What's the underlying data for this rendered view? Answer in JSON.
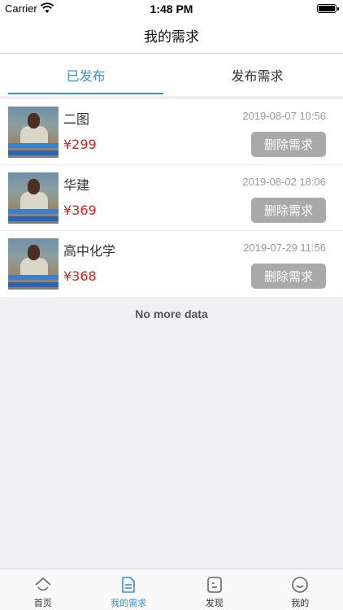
{
  "status_bar": {
    "carrier": "Carrier",
    "time": "1:48 PM"
  },
  "navbar": {
    "title": "我的需求"
  },
  "tabs": [
    {
      "label": "已发布",
      "active": true
    },
    {
      "label": "发布需求",
      "active": false
    }
  ],
  "items": [
    {
      "name": "二图",
      "price": "¥299",
      "date": "2019-08-07 10:56",
      "delete_label": "删除需求"
    },
    {
      "name": "华建",
      "price": "¥369",
      "date": "2019-08-02 18:06",
      "delete_label": "删除需求"
    },
    {
      "name": "高中化学",
      "price": "¥368",
      "date": "2019-07-29 11:56",
      "delete_label": "删除需求"
    }
  ],
  "footer_text": "No more data",
  "tabbar": [
    {
      "label": "首页",
      "icon": "home-icon",
      "active": false
    },
    {
      "label": "我的需求",
      "icon": "document-icon",
      "active": true
    },
    {
      "label": "发现",
      "icon": "discover-icon",
      "active": false
    },
    {
      "label": "我的",
      "icon": "smile-icon",
      "active": false
    }
  ],
  "colors": {
    "accent": "#3a8fd6",
    "price": "#e02020",
    "delete_button": "#a9a9a9"
  }
}
